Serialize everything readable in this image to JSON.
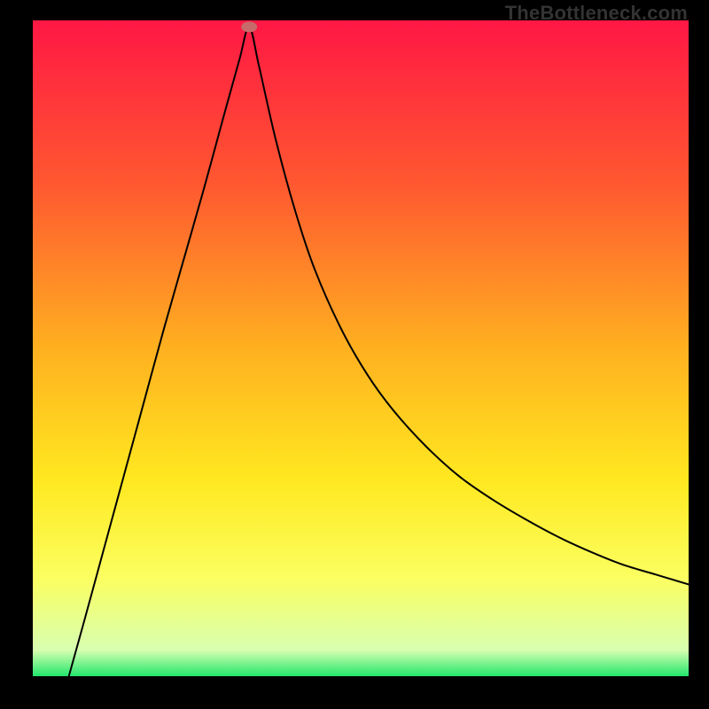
{
  "watermark": "TheBottleneck.com",
  "chart_data": {
    "type": "line",
    "title": "",
    "xlabel": "",
    "ylabel": "",
    "xlim": [
      0,
      100
    ],
    "ylim": [
      0,
      100
    ],
    "grid": false,
    "legend": false,
    "background_gradient": {
      "stops": [
        {
          "offset": 0,
          "color": "#ff1744"
        },
        {
          "offset": 25,
          "color": "#ff5830"
        },
        {
          "offset": 50,
          "color": "#ffb020"
        },
        {
          "offset": 70,
          "color": "#ffe820"
        },
        {
          "offset": 85,
          "color": "#fbff60"
        },
        {
          "offset": 96,
          "color": "#d8ffb0"
        },
        {
          "offset": 100,
          "color": "#22e66c"
        }
      ]
    },
    "marker": {
      "x": 33.0,
      "y": 99.0,
      "color": "#c76a6a"
    },
    "series": [
      {
        "name": "curve",
        "color": "#000000",
        "x": [
          5.5,
          8,
          11,
          14,
          17,
          20,
          23,
          26,
          29,
          31.5,
          33.0,
          34.5,
          37,
          40,
          43,
          47,
          51,
          55,
          60,
          65,
          70,
          75,
          80,
          85,
          90,
          95,
          100
        ],
        "y": [
          0,
          9,
          20,
          31,
          42,
          53,
          63.5,
          74,
          85,
          94,
          99,
          93,
          82,
          71,
          62,
          53,
          46,
          40.5,
          35,
          30.5,
          27,
          24,
          21.3,
          19,
          17,
          15.5,
          14
        ]
      }
    ]
  }
}
